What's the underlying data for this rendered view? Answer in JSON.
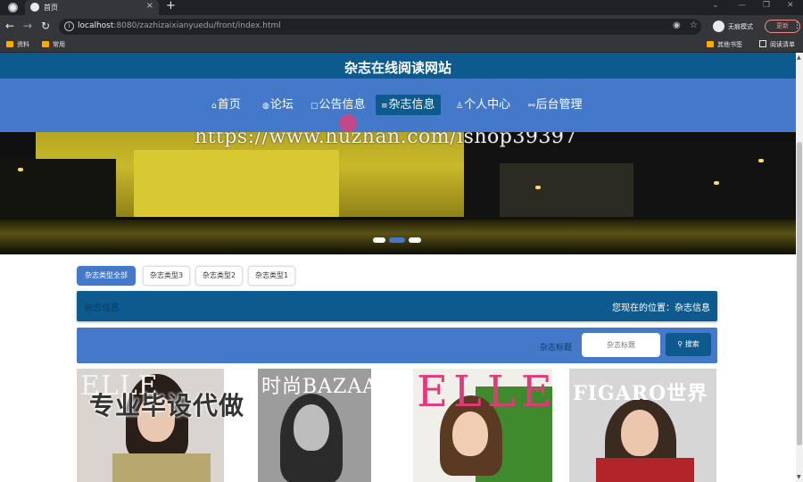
{
  "browser": {
    "tab_title": "首页",
    "tab_close": "×",
    "new_tab": "+",
    "url_host": "localhost",
    "url_path": ":8080/zazhizaixianyuedu/front/index.html",
    "incognito_label": "无痕模式",
    "update_label": "更新",
    "bookmarks": [
      "资料",
      "常用"
    ],
    "other_bookmarks": "其他书签",
    "reading_list": "阅读清单",
    "window_controls": [
      "⌄",
      "—",
      "❐",
      "✕"
    ]
  },
  "site": {
    "title": "杂志在线阅读网站",
    "nav": [
      {
        "icon": "⌂",
        "label": "首页",
        "active": false
      },
      {
        "icon": "◍",
        "label": "论坛",
        "active": false
      },
      {
        "icon": "▢",
        "label": "公告信息",
        "active": false
      },
      {
        "icon": "≡",
        "label": "杂志信息",
        "active": true
      },
      {
        "icon": "♙",
        "label": "个人中心",
        "active": false
      },
      {
        "icon": "⚯",
        "label": "后台管理",
        "active": false
      }
    ]
  },
  "banner": {
    "watermark": "https://www.huzhan.com/ishop39397",
    "active_slide": 2,
    "slides": 3
  },
  "filters": [
    {
      "label": "杂志类型全部",
      "active": true
    },
    {
      "label": "杂志类型3",
      "active": false
    },
    {
      "label": "杂志类型2",
      "active": false
    },
    {
      "label": "杂志类型1",
      "active": false
    }
  ],
  "breadcrumb": {
    "section": "杂志信息",
    "location": "您现在的位置：杂志信息"
  },
  "search": {
    "label": "杂志标题",
    "placeholder": "杂志标题",
    "button": "搜索"
  },
  "covers": [
    {
      "masthead": "ELLE",
      "masthead_color": "#e8e8e8"
    },
    {
      "masthead": "时尚BAZAAR",
      "masthead_color": "#ffffff"
    },
    {
      "masthead": "ELLE",
      "masthead_color": "#e3387a"
    },
    {
      "masthead": "FIGARO世界",
      "masthead_color": "#ffffff"
    }
  ],
  "overlay_text": "专业毕设代做",
  "colors": {
    "header": "#0d5a8e",
    "nav": "#4478c8",
    "active": "#0d5a8e"
  }
}
